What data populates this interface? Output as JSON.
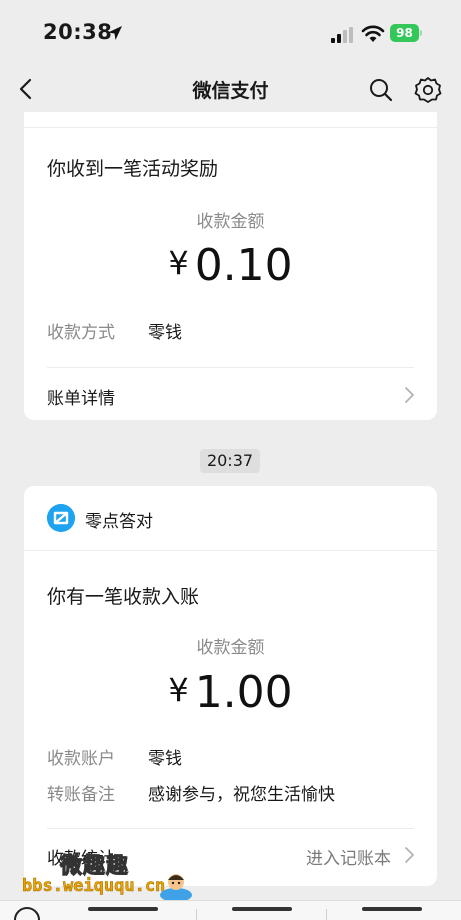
{
  "status_bar": {
    "time": "20:38",
    "battery": "98"
  },
  "nav": {
    "title": "微信支付"
  },
  "card_reward": {
    "title": "你收到一笔活动奖励",
    "amount_label": "收款金额",
    "currency": "¥",
    "amount": "0.10",
    "method_label": "收款方式",
    "method_value": "零钱",
    "detail_link": "账单详情"
  },
  "timestamp": "20:37",
  "card_payment": {
    "brand": "零点答对",
    "title": "你有一笔收款入账",
    "amount_label": "收款金额",
    "currency": "¥",
    "amount": "1.00",
    "account_label": "收款账户",
    "account_value": "零钱",
    "note_label": "转账备注",
    "note_value": "感谢参与，祝您生活愉快",
    "stats_label": "收款统计",
    "stats_link": "进入记账本"
  },
  "watermark": {
    "top": "微趣趣",
    "bottom": "bbs.weiququ.cn"
  },
  "colors": {
    "background": "#ededed",
    "battery": "#34c759",
    "brand_icon": "#1ea3f0",
    "watermark": "#e8a400"
  },
  "icons": [
    "location-arrow-icon",
    "signal-icon",
    "wifi-icon",
    "back-icon",
    "search-icon",
    "gear-icon",
    "chevron-right-icon",
    "mini-program-icon"
  ]
}
